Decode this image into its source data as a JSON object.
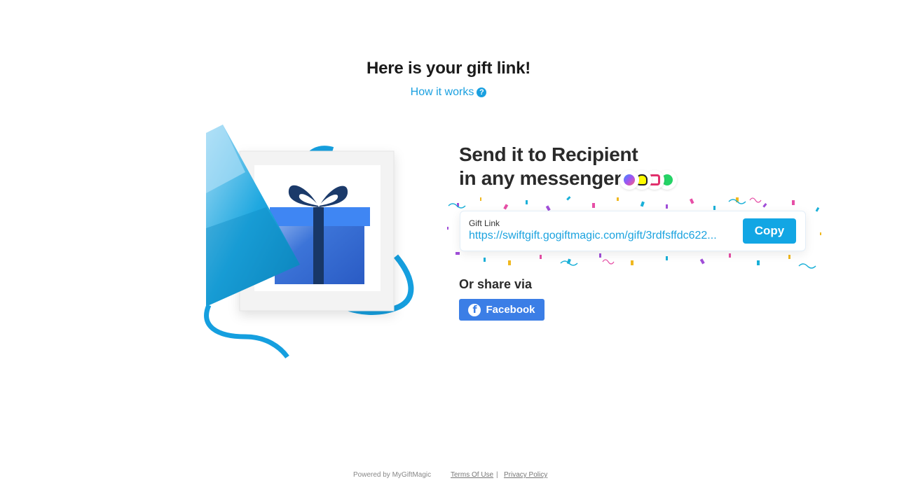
{
  "header": {
    "title": "Here is your gift link!",
    "how_it_works_label": "How it works",
    "help_icon": "question-circle-icon"
  },
  "send": {
    "title_line1": "Send it to Recipient",
    "title_line2": "in any messenger",
    "messenger_icons": [
      {
        "name": "messenger-icon",
        "color": "#a054f0"
      },
      {
        "name": "snapchat-icon",
        "color": "#fffc00"
      },
      {
        "name": "instagram-icon",
        "color": "#e1306c"
      },
      {
        "name": "whatsapp-icon",
        "color": "#25d366"
      }
    ]
  },
  "gift_link": {
    "label": "Gift Link",
    "value": "https://swiftgift.gogiftmagic.com/gift/3rdfsffdc622...",
    "copy_label": "Copy"
  },
  "share": {
    "label": "Or share via",
    "facebook_label": "Facebook",
    "facebook_icon": "f"
  },
  "footer": {
    "powered_by": "Powered by MyGiftMagic",
    "terms": "Terms Of Use",
    "separator": "|",
    "privacy": "Privacy Policy"
  },
  "colors": {
    "accent": "#12a6e4",
    "link": "#1ca3df",
    "facebook": "#3b7ee6"
  }
}
